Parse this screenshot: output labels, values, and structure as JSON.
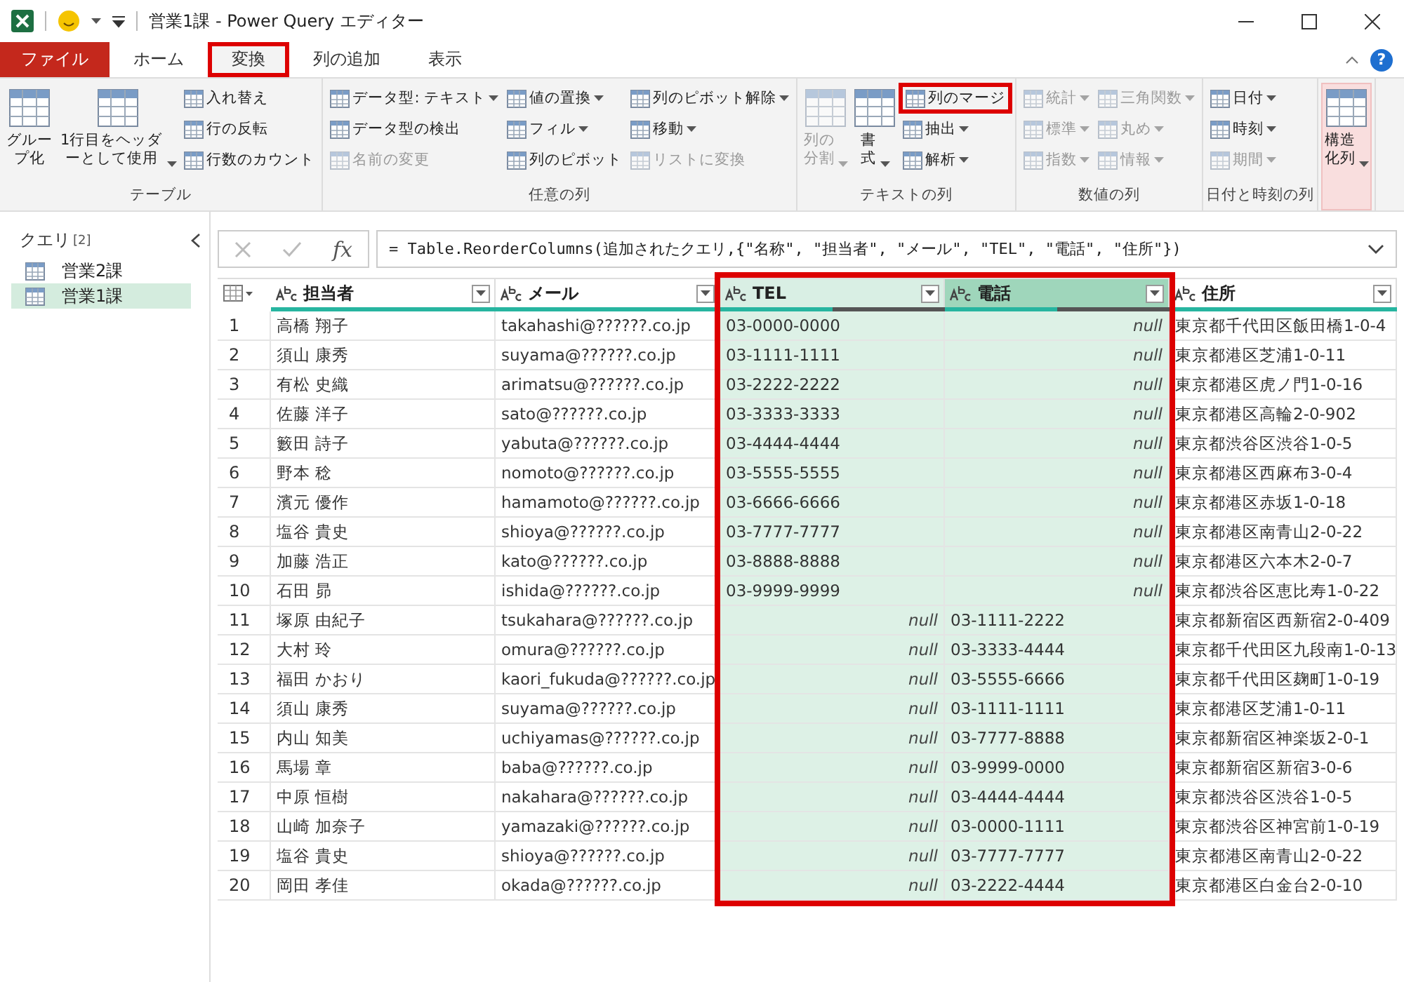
{
  "window": {
    "title": "営業1課 - Power Query エディター"
  },
  "tabs": [
    {
      "label": "ファイル",
      "kind": "file",
      "selected": false,
      "highlighted": false
    },
    {
      "label": "ホーム",
      "kind": "tab",
      "selected": false,
      "highlighted": false
    },
    {
      "label": "変換",
      "kind": "tab",
      "selected": true,
      "highlighted": true
    },
    {
      "label": "列の追加",
      "kind": "tab",
      "selected": false,
      "highlighted": false
    },
    {
      "label": "表示",
      "kind": "tab",
      "selected": false,
      "highlighted": false
    }
  ],
  "help": "?",
  "ribbon": {
    "groups": [
      {
        "label": "テーブル",
        "columns": [
          [
            {
              "label": "グループ化",
              "kind": "large",
              "disabled": false,
              "pressed": false,
              "dropdown": false,
              "highlighted": false
            }
          ],
          [
            {
              "label": "1行目をヘッダーとして使用",
              "kind": "large",
              "disabled": false,
              "pressed": false,
              "dropdown": true,
              "highlighted": false
            }
          ],
          [
            {
              "label": "入れ替え",
              "kind": "small",
              "disabled": false,
              "pressed": false,
              "dropdown": false,
              "highlighted": false
            },
            {
              "label": "行の反転",
              "kind": "small",
              "disabled": false,
              "pressed": false,
              "dropdown": false,
              "highlighted": false
            },
            {
              "label": "行数のカウント",
              "kind": "small",
              "disabled": false,
              "pressed": false,
              "dropdown": false,
              "highlighted": false
            }
          ]
        ]
      },
      {
        "label": "任意の列",
        "columns": [
          [
            {
              "label": "データ型: テキスト",
              "kind": "small",
              "disabled": false,
              "pressed": false,
              "dropdown": true,
              "highlighted": false
            },
            {
              "label": "データ型の検出",
              "kind": "small",
              "disabled": false,
              "pressed": false,
              "dropdown": false,
              "highlighted": false
            },
            {
              "label": "名前の変更",
              "kind": "small",
              "disabled": true,
              "pressed": false,
              "dropdown": false,
              "highlighted": false
            }
          ],
          [
            {
              "label": "値の置換",
              "kind": "small",
              "disabled": false,
              "pressed": false,
              "dropdown": true,
              "highlighted": false
            },
            {
              "label": "フィル",
              "kind": "small",
              "disabled": false,
              "pressed": false,
              "dropdown": true,
              "highlighted": false
            },
            {
              "label": "列のピボット",
              "kind": "small",
              "disabled": false,
              "pressed": false,
              "dropdown": false,
              "highlighted": false
            }
          ],
          [
            {
              "label": "列のピボット解除",
              "kind": "small",
              "disabled": false,
              "pressed": false,
              "dropdown": true,
              "highlighted": false
            },
            {
              "label": "移動",
              "kind": "small",
              "disabled": false,
              "pressed": false,
              "dropdown": true,
              "highlighted": false
            },
            {
              "label": "リストに変換",
              "kind": "small",
              "disabled": true,
              "pressed": false,
              "dropdown": false,
              "highlighted": false
            }
          ]
        ]
      },
      {
        "label": "テキストの列",
        "columns": [
          [
            {
              "label": "列の分割",
              "kind": "large",
              "disabled": true,
              "pressed": false,
              "dropdown": true,
              "highlighted": false
            }
          ],
          [
            {
              "label": "書式",
              "kind": "large",
              "disabled": false,
              "pressed": false,
              "dropdown": true,
              "highlighted": false
            }
          ],
          [
            {
              "label": "列のマージ",
              "kind": "small",
              "disabled": false,
              "pressed": false,
              "dropdown": false,
              "highlighted": true
            },
            {
              "label": "抽出",
              "kind": "small",
              "disabled": false,
              "pressed": false,
              "dropdown": true,
              "highlighted": false
            },
            {
              "label": "解析",
              "kind": "small",
              "disabled": false,
              "pressed": false,
              "dropdown": true,
              "highlighted": false
            }
          ]
        ]
      },
      {
        "label": "数値の列",
        "columns": [
          [
            {
              "label": "統計",
              "kind": "small",
              "disabled": true,
              "pressed": false,
              "dropdown": true,
              "highlighted": false
            },
            {
              "label": "標準",
              "kind": "small",
              "disabled": true,
              "pressed": false,
              "dropdown": true,
              "highlighted": false
            },
            {
              "label": "指数",
              "kind": "small",
              "disabled": true,
              "pressed": false,
              "dropdown": true,
              "highlighted": false
            }
          ],
          [
            {
              "label": "三角関数",
              "kind": "small",
              "disabled": true,
              "pressed": false,
              "dropdown": true,
              "highlighted": false
            },
            {
              "label": "丸め",
              "kind": "small",
              "disabled": true,
              "pressed": false,
              "dropdown": true,
              "highlighted": false
            },
            {
              "label": "情報",
              "kind": "small",
              "disabled": true,
              "pressed": false,
              "dropdown": true,
              "highlighted": false
            }
          ]
        ]
      },
      {
        "label": "日付と時刻の列",
        "columns": [
          [
            {
              "label": "日付",
              "kind": "small",
              "disabled": false,
              "pressed": false,
              "dropdown": true,
              "highlighted": false
            },
            {
              "label": "時刻",
              "kind": "small",
              "disabled": false,
              "pressed": false,
              "dropdown": true,
              "highlighted": false
            },
            {
              "label": "期間",
              "kind": "small",
              "disabled": true,
              "pressed": false,
              "dropdown": true,
              "highlighted": false
            }
          ]
        ]
      },
      {
        "columns": [
          [
            {
              "label": "構造化列",
              "kind": "large",
              "disabled": false,
              "pressed": true,
              "dropdown": true,
              "highlighted": false
            }
          ]
        ]
      }
    ]
  },
  "queries": {
    "title": "クエリ",
    "count": "[2]",
    "items": [
      {
        "label": "営業2課",
        "selected": false
      },
      {
        "label": "営業1課",
        "selected": true
      }
    ]
  },
  "formula": {
    "fx": "fx",
    "text": "= Table.ReorderColumns(追加されたクエリ,{\"名称\", \"担当者\", \"メール\", \"TEL\", \"電話\", \"住所\"})"
  },
  "table": {
    "columns": [
      {
        "name": "担当者",
        "selected": false,
        "focused": false,
        "highlighted": false,
        "level": 1
      },
      {
        "name": "メール",
        "selected": false,
        "focused": false,
        "highlighted": false,
        "level": 1
      },
      {
        "name": "TEL",
        "selected": true,
        "focused": false,
        "highlighted": true,
        "level": 0.5
      },
      {
        "name": "電話",
        "selected": true,
        "focused": true,
        "highlighted": true,
        "level": 0.5
      },
      {
        "name": "住所",
        "selected": false,
        "focused": false,
        "highlighted": false,
        "level": 1
      }
    ],
    "rows": [
      {
        "index": "1",
        "cells": [
          "高橋 翔子",
          "takahashi@??????.co.jp",
          {
            "text": "03-0000-0000",
            "is_null": false
          },
          {
            "text": "null",
            "is_null": true
          },
          "東京都千代田区飯田橋1-0-4"
        ]
      },
      {
        "index": "2",
        "cells": [
          "須山 康秀",
          "suyama@??????.co.jp",
          {
            "text": "03-1111-1111",
            "is_null": false
          },
          {
            "text": "null",
            "is_null": true
          },
          "東京都港区芝浦1-0-11"
        ]
      },
      {
        "index": "3",
        "cells": [
          "有松 史織",
          "arimatsu@??????.co.jp",
          {
            "text": "03-2222-2222",
            "is_null": false
          },
          {
            "text": "null",
            "is_null": true
          },
          "東京都港区虎ノ門1-0-16"
        ]
      },
      {
        "index": "4",
        "cells": [
          "佐藤 洋子",
          "sato@??????.co.jp",
          {
            "text": "03-3333-3333",
            "is_null": false
          },
          {
            "text": "null",
            "is_null": true
          },
          "東京都港区高輪2-0-902"
        ]
      },
      {
        "index": "5",
        "cells": [
          "籔田 詩子",
          "yabuta@??????.co.jp",
          {
            "text": "03-4444-4444",
            "is_null": false
          },
          {
            "text": "null",
            "is_null": true
          },
          "東京都渋谷区渋谷1-0-5"
        ]
      },
      {
        "index": "6",
        "cells": [
          "野本 稔",
          "nomoto@??????.co.jp",
          {
            "text": "03-5555-5555",
            "is_null": false
          },
          {
            "text": "null",
            "is_null": true
          },
          "東京都港区西麻布3-0-4"
        ]
      },
      {
        "index": "7",
        "cells": [
          "濱元 優作",
          "hamamoto@??????.co.jp",
          {
            "text": "03-6666-6666",
            "is_null": false
          },
          {
            "text": "null",
            "is_null": true
          },
          "東京都港区赤坂1-0-18"
        ]
      },
      {
        "index": "8",
        "cells": [
          "塩谷 貴史",
          "shioya@??????.co.jp",
          {
            "text": "03-7777-7777",
            "is_null": false
          },
          {
            "text": "null",
            "is_null": true
          },
          "東京都港区南青山2-0-22"
        ]
      },
      {
        "index": "9",
        "cells": [
          "加藤 浩正",
          "kato@??????.co.jp",
          {
            "text": "03-8888-8888",
            "is_null": false
          },
          {
            "text": "null",
            "is_null": true
          },
          "東京都港区六本木2-0-7"
        ]
      },
      {
        "index": "10",
        "cells": [
          "石田 昴",
          "ishida@??????.co.jp",
          {
            "text": "03-9999-9999",
            "is_null": false
          },
          {
            "text": "null",
            "is_null": true
          },
          "東京都渋谷区恵比寿1-0-22"
        ]
      },
      {
        "index": "11",
        "cells": [
          "塚原 由紀子",
          "tsukahara@??????.co.jp",
          {
            "text": "null",
            "is_null": true
          },
          {
            "text": "03-1111-2222",
            "is_null": false
          },
          "東京都新宿区西新宿2-0-409"
        ]
      },
      {
        "index": "12",
        "cells": [
          "大村 玲",
          "omura@??????.co.jp",
          {
            "text": "null",
            "is_null": true
          },
          {
            "text": "03-3333-4444",
            "is_null": false
          },
          "東京都千代田区九段南1-0-13"
        ]
      },
      {
        "index": "13",
        "cells": [
          "福田 かおり",
          "kaori_fukuda@??????.co.jp",
          {
            "text": "null",
            "is_null": true
          },
          {
            "text": "03-5555-6666",
            "is_null": false
          },
          "東京都千代田区麹町1-0-19"
        ]
      },
      {
        "index": "14",
        "cells": [
          "須山 康秀",
          "suyama@??????.co.jp",
          {
            "text": "null",
            "is_null": true
          },
          {
            "text": "03-1111-1111",
            "is_null": false
          },
          "東京都港区芝浦1-0-11"
        ]
      },
      {
        "index": "15",
        "cells": [
          "内山 知美",
          "uchiyamas@??????.co.jp",
          {
            "text": "null",
            "is_null": true
          },
          {
            "text": "03-7777-8888",
            "is_null": false
          },
          "東京都新宿区神楽坂2-0-1"
        ]
      },
      {
        "index": "16",
        "cells": [
          "馬場 章",
          "baba@??????.co.jp",
          {
            "text": "null",
            "is_null": true
          },
          {
            "text": "03-9999-0000",
            "is_null": false
          },
          "東京都新宿区新宿3-0-6"
        ]
      },
      {
        "index": "17",
        "cells": [
          "中原 恒樹",
          "nakahara@??????.co.jp",
          {
            "text": "null",
            "is_null": true
          },
          {
            "text": "03-4444-4444",
            "is_null": false
          },
          "東京都渋谷区渋谷1-0-5"
        ]
      },
      {
        "index": "18",
        "cells": [
          "山崎 加奈子",
          "yamazaki@??????.co.jp",
          {
            "text": "null",
            "is_null": true
          },
          {
            "text": "03-0000-1111",
            "is_null": false
          },
          "東京都渋谷区神宮前1-0-19"
        ]
      },
      {
        "index": "19",
        "cells": [
          "塩谷 貴史",
          "shioya@??????.co.jp",
          {
            "text": "null",
            "is_null": true
          },
          {
            "text": "03-7777-7777",
            "is_null": false
          },
          "東京都港区南青山2-0-22"
        ]
      },
      {
        "index": "20",
        "cells": [
          "岡田 孝佳",
          "okada@??????.co.jp",
          {
            "text": "null",
            "is_null": true
          },
          {
            "text": "03-2222-4444",
            "is_null": false
          },
          "東京都港区白金台2-0-10"
        ]
      }
    ]
  }
}
